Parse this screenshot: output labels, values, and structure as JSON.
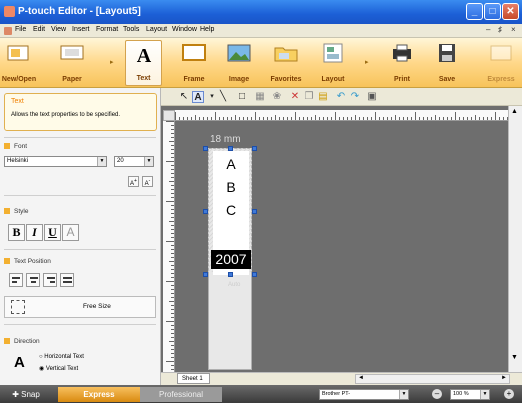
{
  "window": {
    "title": "P-touch Editor - [Layout5]",
    "controls": [
      "_",
      "□",
      "✕"
    ]
  },
  "menu": {
    "items": [
      "File",
      "Edit",
      "View",
      "Insert",
      "Format",
      "Tools",
      "Layout",
      "Window",
      "Help"
    ],
    "mdi_controls": [
      "–",
      "♯",
      "×"
    ]
  },
  "ribbon": {
    "buttons": [
      {
        "label": "New/Open",
        "icon": "new-open-icon"
      },
      {
        "label": "Paper",
        "icon": "paper-icon"
      },
      {
        "label": "Text",
        "icon": "text-icon"
      },
      {
        "label": "Frame",
        "icon": "frame-icon"
      },
      {
        "label": "Image",
        "icon": "image-icon"
      },
      {
        "label": "Favorites",
        "icon": "favorites-icon"
      },
      {
        "label": "Layout",
        "icon": "layout-icon"
      },
      {
        "label": "Print",
        "icon": "print-icon"
      },
      {
        "label": "Save",
        "icon": "save-icon"
      },
      {
        "label": "Express",
        "icon": "express-icon"
      }
    ],
    "active": "Text"
  },
  "panel": {
    "help_title": "Text",
    "help_text": "Allows the text properties to be specified.",
    "font_section": "Font",
    "font_name": "Helsinki",
    "font_size": "20",
    "style_section": "Style",
    "style_buttons": [
      "B",
      "I",
      "U",
      "A"
    ],
    "text_position_section": "Text Position",
    "free_size_label": "Free Size",
    "direction_section": "Direction",
    "direction_options": [
      "Horizontal Text",
      "Vertical Text"
    ],
    "direction_selected": "Vertical Text"
  },
  "canvas": {
    "size_indicator": "18 mm",
    "letters": [
      "A",
      "B",
      "C"
    ],
    "year_text": "2007",
    "auto_label": "Auto"
  },
  "sheet": {
    "tab_label": "Sheet 1"
  },
  "status": {
    "tabs": [
      "Snap",
      "Express",
      "Professional"
    ],
    "active_tab": "Express",
    "printer": "Brother PT-",
    "zoom": "100 %"
  }
}
